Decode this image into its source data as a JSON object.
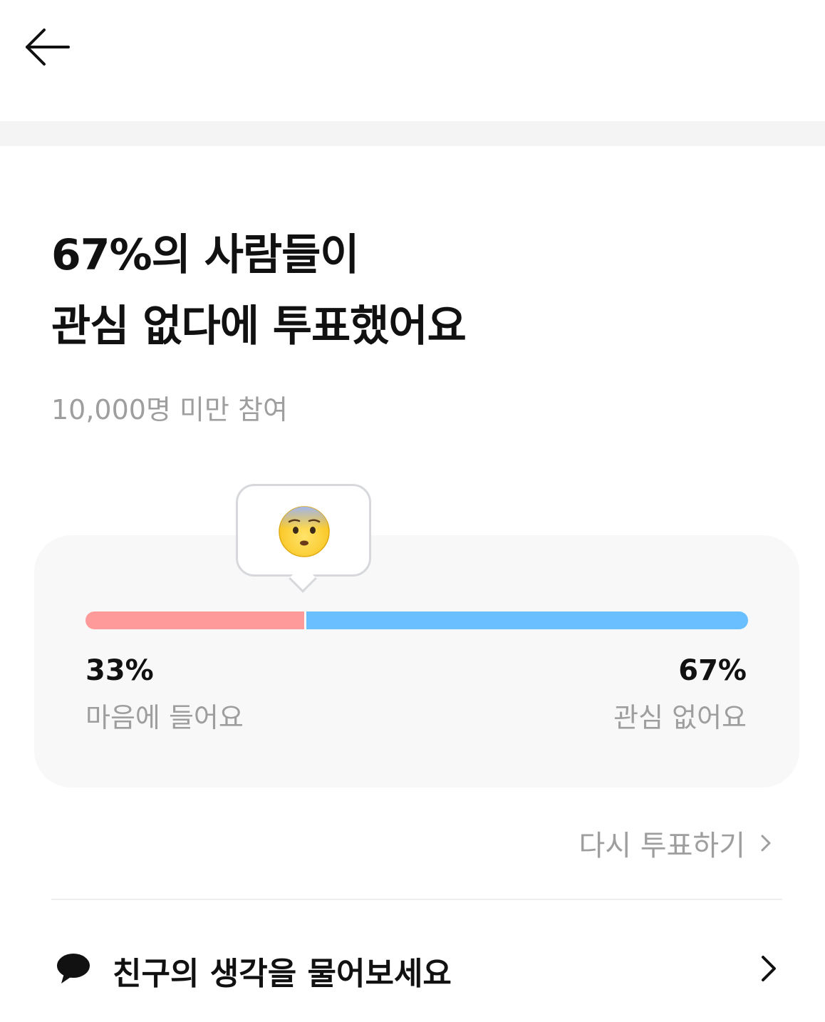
{
  "header": {
    "back_icon": "arrow-left-icon"
  },
  "result": {
    "headline_line1": "67%의 사람들이",
    "headline_line2": "관심 없다에 투표했어요",
    "participants": "10,000명 미만 참여",
    "reaction_icon": "anxious-face-emoji-icon",
    "left_option": {
      "percent_text": "33%",
      "label": "마음에 들어요",
      "share": 0.33,
      "color": "#ff9a9a"
    },
    "right_option": {
      "percent_text": "67%",
      "label": "관심 없어요",
      "share": 0.67,
      "color": "#6abfff"
    }
  },
  "revote": {
    "label": "다시 투표하기",
    "icon": "chevron-right-icon"
  },
  "ask_friends": {
    "label": "친구의 생각을 물어보세요",
    "icon": "speech-bubble-icon",
    "chevron": "chevron-right-icon"
  }
}
